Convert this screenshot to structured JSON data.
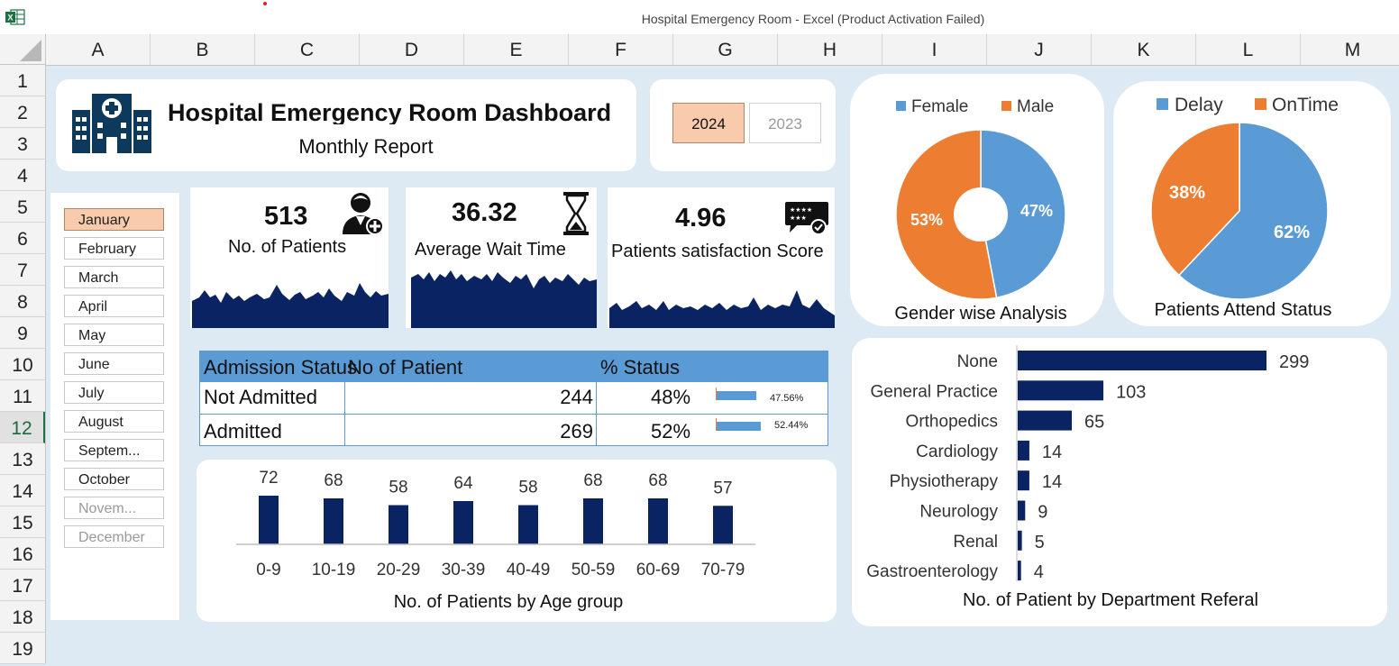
{
  "window": {
    "title": "Hospital Emergency Room - Excel (Product Activation Failed)"
  },
  "sheet": {
    "columns": [
      "A",
      "B",
      "C",
      "D",
      "E",
      "F",
      "G",
      "H",
      "I",
      "J",
      "K",
      "L",
      "M"
    ],
    "rows": [
      "1",
      "2",
      "3",
      "4",
      "5",
      "6",
      "7",
      "8",
      "9",
      "10",
      "11",
      "12",
      "13",
      "14",
      "15",
      "16",
      "17",
      "18",
      "19"
    ],
    "selected_row": "12"
  },
  "header": {
    "title": "Hospital Emergency Room Dashboard",
    "subtitle": "Monthly Report",
    "icon": "hospital-icon"
  },
  "years": {
    "items": [
      {
        "label": "2024",
        "selected": true
      },
      {
        "label": "2023",
        "selected": false
      }
    ]
  },
  "months": {
    "items": [
      {
        "label": "January",
        "state": "active"
      },
      {
        "label": "February",
        "state": "normal"
      },
      {
        "label": "March",
        "state": "normal"
      },
      {
        "label": "April",
        "state": "normal"
      },
      {
        "label": "May",
        "state": "normal"
      },
      {
        "label": "June",
        "state": "normal"
      },
      {
        "label": "July",
        "state": "normal"
      },
      {
        "label": "August",
        "state": "normal"
      },
      {
        "label": "Septem...",
        "state": "normal"
      },
      {
        "label": "October",
        "state": "normal"
      },
      {
        "label": "Novem...",
        "state": "dim"
      },
      {
        "label": "December",
        "state": "dim"
      }
    ]
  },
  "kpis": {
    "patients": {
      "value": "513",
      "label": "No. of Patients",
      "icon": "patient-icon"
    },
    "wait": {
      "value": "36.32",
      "label": "Average Wait Time",
      "icon": "hourglass-icon"
    },
    "satisfaction": {
      "value": "4.96",
      "label": "Patients satisfaction Score",
      "icon": "rating-chat-icon"
    }
  },
  "admission": {
    "headers": [
      "Admission Status",
      "No of Patient",
      "% Status"
    ],
    "rows": [
      {
        "status": "Not Admitted",
        "count": "244",
        "pct": "48%",
        "bar_label": "47.56%",
        "bar_fraction": 0.4756
      },
      {
        "status": "Admitted",
        "count": "269",
        "pct": "52%",
        "bar_label": "52.44%",
        "bar_fraction": 0.5244
      }
    ]
  },
  "colors": {
    "navy": "#0a2463",
    "blue": "#5b9bd5",
    "orange": "#ed7d31",
    "peach": "#f8cbad"
  },
  "chart_data": [
    {
      "type": "pie",
      "title": "Gender wise Analysis",
      "donut": true,
      "legend": "top",
      "categories": [
        "Female",
        "Male"
      ],
      "values": [
        47,
        53
      ],
      "labels": [
        "47%",
        "53%"
      ],
      "colors": [
        "#5b9bd5",
        "#ed7d31"
      ]
    },
    {
      "type": "pie",
      "title": "Patients Attend  Status",
      "legend": "top",
      "categories": [
        "Delay",
        "OnTime"
      ],
      "values": [
        62,
        38
      ],
      "labels": [
        "62%",
        "38%"
      ],
      "colors": [
        "#5b9bd5",
        "#ed7d31"
      ]
    },
    {
      "type": "bar",
      "title": "No. of Patients by Age group",
      "categories": [
        "0-9",
        "10-19",
        "20-29",
        "30-39",
        "40-49",
        "50-59",
        "60-69",
        "70-79"
      ],
      "values": [
        72,
        68,
        58,
        64,
        58,
        68,
        68,
        57
      ],
      "color": "#0a2463"
    },
    {
      "type": "bar",
      "orientation": "horizontal",
      "title": "No. of Patient by Department Referal",
      "categories": [
        "None",
        "General Practice",
        "Orthopedics",
        "Cardiology",
        "Physiotherapy",
        "Neurology",
        "Renal",
        "Gastroenterology"
      ],
      "values": [
        299,
        103,
        65,
        14,
        14,
        9,
        5,
        4
      ],
      "color": "#0a2463"
    }
  ]
}
